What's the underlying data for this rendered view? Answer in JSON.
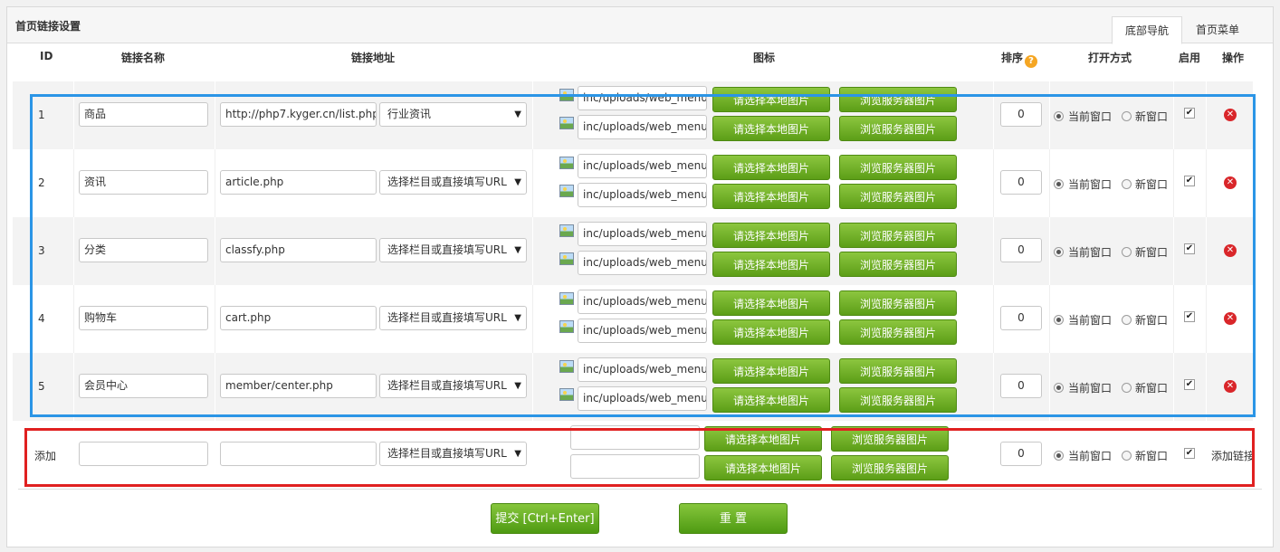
{
  "panel": {
    "title": "首页链接设置"
  },
  "tabs": [
    {
      "label": "底部导航",
      "active": true
    },
    {
      "label": "首页菜单",
      "active": false
    }
  ],
  "headers": {
    "id": "ID",
    "name": "链接名称",
    "url": "链接地址",
    "icon": "图标",
    "sort": "排序",
    "open": "打开方式",
    "enable": "启用",
    "action": "操作"
  },
  "icon_names": {
    "help": "question-mark-icon",
    "picture": "image-icon",
    "delete": "red-x-icon"
  },
  "radio_labels": {
    "current": "当前窗口",
    "new": "新窗口"
  },
  "buttons": {
    "local": "请选择本地图片",
    "server": "浏览服务器图片"
  },
  "rows": [
    {
      "id": "1",
      "name": "商品",
      "url": "http://php7.kyger.cn/list.php",
      "category": "行业资讯",
      "icon1": "inc/uploads/web_menu",
      "icon2": "inc/uploads/web_menu",
      "sort": "0",
      "open": "current",
      "enabled": true
    },
    {
      "id": "2",
      "name": "资讯",
      "url": "article.php",
      "category": "选择栏目或直接填写URL",
      "icon1": "inc/uploads/web_menu",
      "icon2": "inc/uploads/web_menu",
      "sort": "0",
      "open": "current",
      "enabled": true
    },
    {
      "id": "3",
      "name": "分类",
      "url": "classfy.php",
      "category": "选择栏目或直接填写URL",
      "icon1": "inc/uploads/web_menu",
      "icon2": "inc/uploads/web_menu",
      "sort": "0",
      "open": "current",
      "enabled": true
    },
    {
      "id": "4",
      "name": "购物车",
      "url": "cart.php",
      "category": "选择栏目或直接填写URL",
      "icon1": "inc/uploads/web_menu",
      "icon2": "inc/uploads/web_menu",
      "sort": "0",
      "open": "current",
      "enabled": true
    },
    {
      "id": "5",
      "name": "会员中心",
      "url": "member/center.php",
      "category": "选择栏目或直接填写URL",
      "icon1": "inc/uploads/web_menu",
      "icon2": "inc/uploads/web_menu",
      "sort": "0",
      "open": "current",
      "enabled": true
    }
  ],
  "add_row": {
    "label": "添加",
    "name": "",
    "url": "",
    "category": "选择栏目或直接填写URL",
    "icon1": "",
    "icon2": "",
    "sort": "0",
    "open": "current",
    "enabled": true,
    "action": "添加链接"
  },
  "footer": {
    "submit": "提交 [Ctrl+Enter]",
    "reset": "重 置"
  },
  "colors": {
    "green_button": "#6aad1e",
    "highlight_blue": "#2b95e6",
    "highlight_red": "#e02020",
    "delete_red": "#d9262a"
  }
}
